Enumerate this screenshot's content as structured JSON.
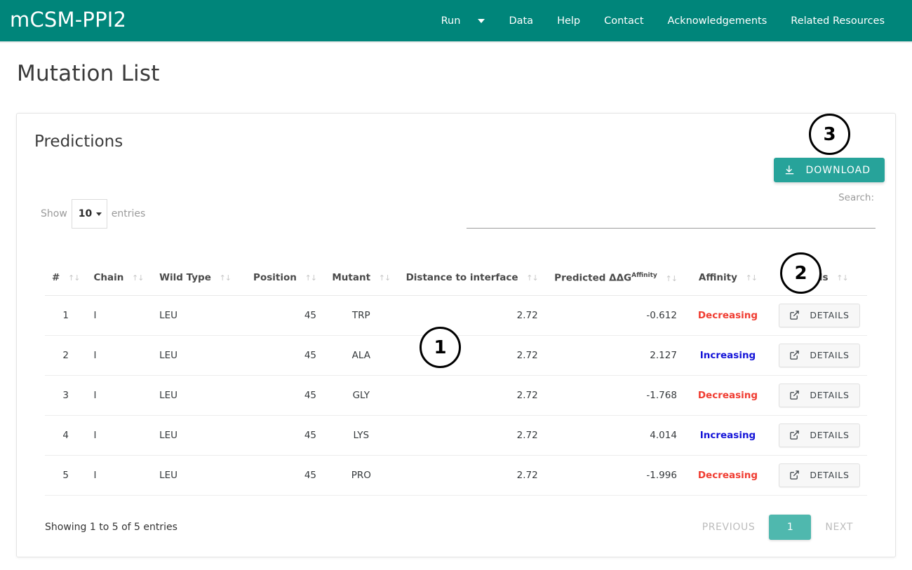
{
  "navbar": {
    "brand": "mCSM-PPI2",
    "items": [
      {
        "label": "Run",
        "has_caret": true
      },
      {
        "label": "Data",
        "has_caret": false
      },
      {
        "label": "Help",
        "has_caret": false
      },
      {
        "label": "Contact",
        "has_caret": false
      },
      {
        "label": "Acknowledgements",
        "has_caret": false
      },
      {
        "label": "Related Resources",
        "has_caret": false
      }
    ],
    "bg_color": "#00857a"
  },
  "page": {
    "title": "Mutation List"
  },
  "card": {
    "title": "Predictions"
  },
  "toolbar": {
    "download_label": "DOWNLOAD",
    "download_color": "#27a39a"
  },
  "controls": {
    "show_label": "Show",
    "entries_label": "entries",
    "page_length": "10",
    "search_label": "Search:",
    "search_value": "",
    "search_placeholder": ""
  },
  "table": {
    "sort_icon": "↑↓",
    "columns": [
      {
        "label": "#",
        "align": "center"
      },
      {
        "label": "Chain",
        "align": "left"
      },
      {
        "label": "Wild Type",
        "align": "left"
      },
      {
        "label": "Position",
        "align": "right"
      },
      {
        "label": "Mutant",
        "align": "center"
      },
      {
        "label": "Distance to interface",
        "align": "right"
      },
      {
        "label": "Predicted ΔΔG",
        "sup": "Affinity",
        "align": "right"
      },
      {
        "label": "Affinity",
        "align": "center"
      },
      {
        "label": "Details",
        "align": "center"
      }
    ],
    "rows": [
      {
        "num": "1",
        "chain": "I",
        "wild_type": "LEU",
        "position": "45",
        "mutant": "TRP",
        "distance": "2.72",
        "ddg": "-0.612",
        "affinity": "Decreasing",
        "affinity_class": "aff-dec",
        "details": "DETAILS"
      },
      {
        "num": "2",
        "chain": "I",
        "wild_type": "LEU",
        "position": "45",
        "mutant": "ALA",
        "distance": "2.72",
        "ddg": "2.127",
        "affinity": "Increasing",
        "affinity_class": "aff-inc",
        "details": "DETAILS"
      },
      {
        "num": "3",
        "chain": "I",
        "wild_type": "LEU",
        "position": "45",
        "mutant": "GLY",
        "distance": "2.72",
        "ddg": "-1.768",
        "affinity": "Decreasing",
        "affinity_class": "aff-dec",
        "details": "DETAILS"
      },
      {
        "num": "4",
        "chain": "I",
        "wild_type": "LEU",
        "position": "45",
        "mutant": "LYS",
        "distance": "2.72",
        "ddg": "4.014",
        "affinity": "Increasing",
        "affinity_class": "aff-inc",
        "details": "DETAILS"
      },
      {
        "num": "5",
        "chain": "I",
        "wild_type": "LEU",
        "position": "45",
        "mutant": "PRO",
        "distance": "2.72",
        "ddg": "-1.996",
        "affinity": "Decreasing",
        "affinity_class": "aff-dec",
        "details": "DETAILS"
      }
    ]
  },
  "footer": {
    "info": "Showing 1 to 5 of 5 entries",
    "previous_label": "PREVIOUS",
    "next_label": "NEXT",
    "current_page": "1",
    "active_color": "#4fb8ae"
  },
  "annotations": [
    {
      "id": "1",
      "label": "1"
    },
    {
      "id": "2",
      "label": "2"
    },
    {
      "id": "3",
      "label": "3"
    }
  ],
  "colors": {
    "decreasing": "#f03d32",
    "increasing": "#1414d8"
  }
}
